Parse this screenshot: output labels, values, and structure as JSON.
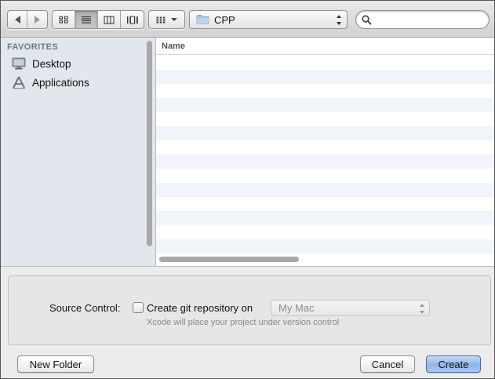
{
  "toolbar": {
    "back_icon": "back-arrow-icon",
    "forward_icon": "forward-arrow-icon",
    "view_modes": [
      "icon-view",
      "list-view",
      "column-view",
      "coverflow-view"
    ],
    "active_view": "list-view",
    "arrange_icon": "arrange-grid-icon",
    "location": "CPP",
    "search_value": "",
    "search_placeholder": ""
  },
  "sidebar": {
    "heading": "FAVORITES",
    "items": [
      {
        "label": "Desktop",
        "icon": "desktop-icon"
      },
      {
        "label": "Applications",
        "icon": "applications-icon"
      }
    ]
  },
  "file_list": {
    "column_header": "Name",
    "rows": []
  },
  "options": {
    "source_control_label": "Source Control:",
    "checkbox_label": "Create git repository on",
    "checkbox_checked": false,
    "location_popup": "My Mac",
    "hint": "Xcode will place your project under version control"
  },
  "buttons": {
    "new_folder": "New Folder",
    "cancel": "Cancel",
    "create": "Create"
  },
  "colors": {
    "sidebar_bg": "#e2e7ee",
    "row_stripe": "#f1f5fb",
    "default_button": "#8fb4ea"
  }
}
